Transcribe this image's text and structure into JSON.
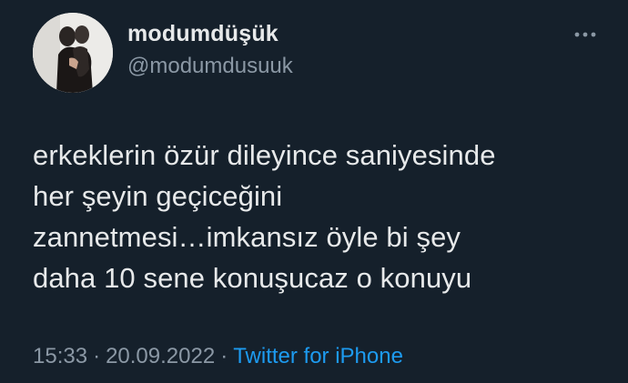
{
  "user": {
    "display_name": "modumdüşük",
    "handle": "@modumdusuuk"
  },
  "tweet": {
    "text": "erkeklerin özür dileyince saniyesinde\nher şeyin geçiceğini\nzannetmesi…imkansız öyle bi şey\ndaha 10 sene konuşucaz o konuyu",
    "time": "15:33",
    "date": "20.09.2022",
    "separator": "·",
    "source": "Twitter for iPhone"
  },
  "icons": {
    "more": "more-options-icon",
    "avatar": "profile-photo"
  },
  "colors": {
    "background": "#15202b",
    "text": "#e7e9ea",
    "muted": "#8b98a5",
    "link": "#1d9bf0"
  }
}
